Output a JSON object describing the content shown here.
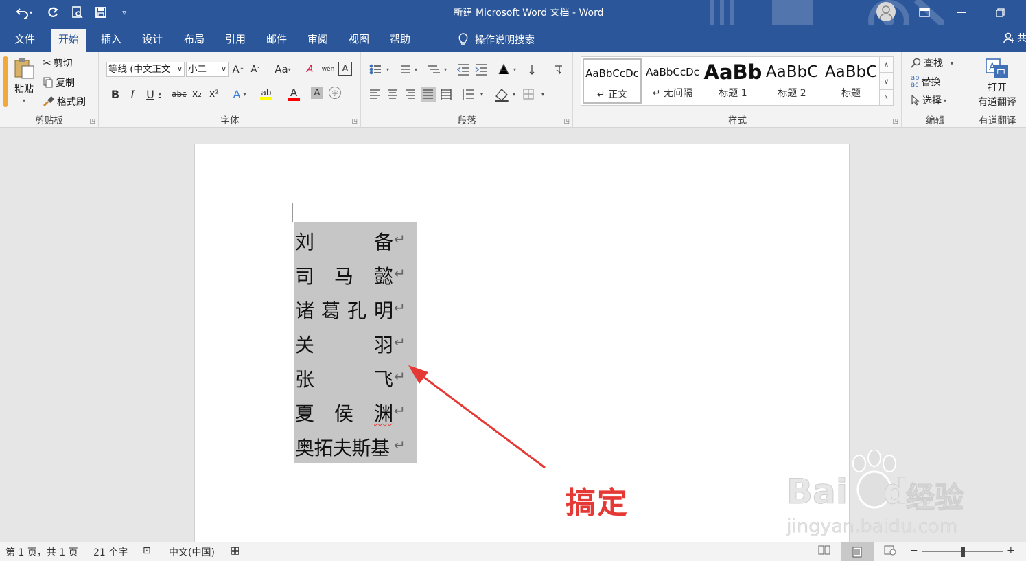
{
  "titlebar": {
    "title": "新建 Microsoft Word 文档  -  Word",
    "undo_icon": "undo-icon",
    "redo_icon": "redo-icon",
    "accent": "#2b579a"
  },
  "tabs": [
    {
      "label": "文件"
    },
    {
      "label": "开始"
    },
    {
      "label": "插入"
    },
    {
      "label": "设计"
    },
    {
      "label": "布局"
    },
    {
      "label": "引用"
    },
    {
      "label": "邮件"
    },
    {
      "label": "审阅"
    },
    {
      "label": "视图"
    },
    {
      "label": "帮助"
    }
  ],
  "tell_me": "操作说明搜索",
  "share_label": "共",
  "clipboard": {
    "paste": "粘贴",
    "cut": "剪切",
    "copy": "复制",
    "format_painter": "格式刷",
    "label": "剪贴板"
  },
  "font": {
    "font_name": "等线 (中文正文",
    "font_size": "小二",
    "label": "字体",
    "bold": "B",
    "italic": "I",
    "underline": "U",
    "strike": "abc",
    "subscript": "x₂",
    "superscript": "x²",
    "grow": "A",
    "shrink": "A",
    "change_case": "Aa",
    "clear": "A",
    "phonetic": "wén",
    "border_char": "A",
    "text_effects": "A",
    "highlight": "ab",
    "font_color": "A",
    "shading": "A",
    "enclose": "字",
    "highlight_color": "#ffff00",
    "font_color_value": "#ff0000"
  },
  "paragraph": {
    "label": "段落"
  },
  "styles": {
    "label": "样式",
    "items": [
      {
        "preview": "AaBbCcDc",
        "name": "↵ 正文"
      },
      {
        "preview": "AaBbCcDc",
        "name": "↵ 无间隔"
      },
      {
        "preview": "AaBb",
        "name": "标题 1"
      },
      {
        "preview": "AaBbC",
        "name": "标题 2"
      },
      {
        "preview": "AaBbC",
        "name": "标题"
      }
    ]
  },
  "editing": {
    "find": "查找",
    "replace": "替换",
    "select": "选择",
    "label": "编辑"
  },
  "translate": {
    "open": "打开",
    "name": "有道翻译",
    "label": "有道翻译"
  },
  "document": {
    "lines": [
      [
        "刘",
        "",
        "",
        "备"
      ],
      [
        "司",
        "马",
        "",
        "懿"
      ],
      [
        "诸",
        "葛",
        "孔",
        "明"
      ],
      [
        "关",
        "",
        "",
        "羽"
      ],
      [
        "张",
        "",
        "",
        "飞"
      ],
      [
        "夏",
        "侯",
        "",
        "渊"
      ],
      [
        "奥拓夫斯基",
        "",
        "",
        ""
      ]
    ],
    "para_mark": "↵",
    "annotation": "搞定",
    "annotation_color": "#e53935",
    "selection_color": "#c6c6c6"
  },
  "watermark": {
    "brand": "Bai",
    "brand2": "du",
    "jingyan": "经验",
    "url": "jingyan.baidu.com"
  },
  "statusbar": {
    "page": "第 1 页，共 1 页",
    "words": "21 个字",
    "language": "中文(中国)",
    "zoom_minus": "−",
    "zoom_plus": "+"
  }
}
